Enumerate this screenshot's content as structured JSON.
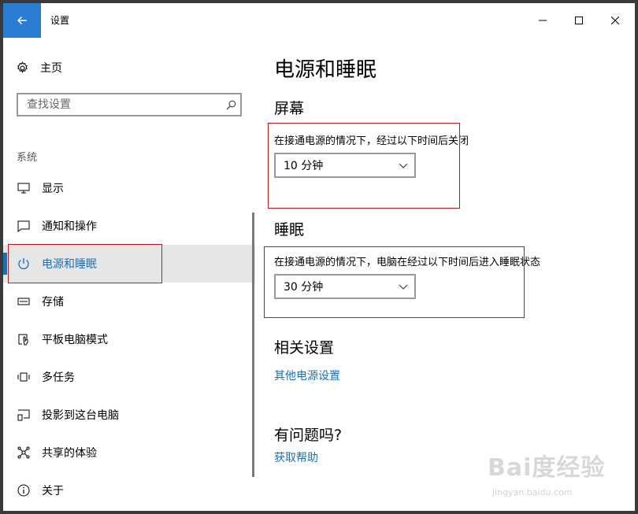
{
  "window": {
    "title": "设置"
  },
  "sidebar": {
    "home_label": "主页",
    "search_placeholder": "查找设置",
    "section_label": "系统",
    "items": [
      {
        "label": "显示",
        "icon": "monitor-icon"
      },
      {
        "label": "通知和操作",
        "icon": "message-icon"
      },
      {
        "label": "电源和睡眠",
        "icon": "power-icon",
        "active": true
      },
      {
        "label": "存储",
        "icon": "drive-icon"
      },
      {
        "label": "平板电脑模式",
        "icon": "tablet-mode-icon"
      },
      {
        "label": "多任务",
        "icon": "multitask-icon"
      },
      {
        "label": "投影到这台电脑",
        "icon": "project-icon"
      },
      {
        "label": "共享的体验",
        "icon": "share-icon"
      },
      {
        "label": "关于",
        "icon": "info-icon"
      }
    ]
  },
  "content": {
    "page_title": "电源和睡眠",
    "screen": {
      "heading": "屏幕",
      "label": "在接通电源的情况下，经过以下时间后关闭",
      "value": "10 分钟"
    },
    "sleep": {
      "heading": "睡眠",
      "label": "在接通电源的情况下，电脑在经过以下时间后进入睡眠状态",
      "value": "30 分钟"
    },
    "related": {
      "heading": "相关设置",
      "link": "其他电源设置"
    },
    "question": {
      "heading": "有问题吗?",
      "link": "获取帮助"
    }
  },
  "colors": {
    "accent": "#1a6fb8",
    "titlebar_back": "#2b7cd3",
    "highlight_box": "#c0191d"
  },
  "watermark": {
    "logo": "Bai度经验",
    "url": "jingyan.baidu.com"
  }
}
